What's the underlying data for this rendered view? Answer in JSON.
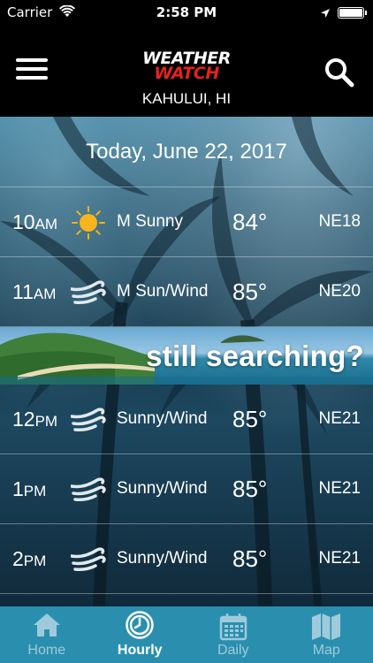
{
  "status_bar": {
    "carrier": "Carrier",
    "time": "2:58 PM"
  },
  "header": {
    "logo_line1": "WEATHER",
    "logo_line2": "WATCH",
    "location": "KAHULUI, HI"
  },
  "forecast": {
    "date": "Today, June 22, 2017",
    "hours": [
      {
        "hour": "10",
        "ampm": "AM",
        "icon": "sun-icon",
        "condition": "M Sunny",
        "temp": "84°",
        "wind": "NE18"
      },
      {
        "hour": "11",
        "ampm": "AM",
        "icon": "wind-icon",
        "condition": "M Sun/Wind",
        "temp": "85°",
        "wind": "NE20"
      },
      {
        "hour": "12",
        "ampm": "PM",
        "icon": "wind-icon",
        "condition": "Sunny/Wind",
        "temp": "85°",
        "wind": "NE21"
      },
      {
        "hour": "1",
        "ampm": "PM",
        "icon": "wind-icon",
        "condition": "Sunny/Wind",
        "temp": "85°",
        "wind": "NE21"
      },
      {
        "hour": "2",
        "ampm": "PM",
        "icon": "wind-icon",
        "condition": "Sunny/Wind",
        "temp": "85°",
        "wind": "NE21"
      }
    ]
  },
  "ad": {
    "text": "still searching?"
  },
  "tabs": [
    {
      "label": "Home",
      "icon": "home-icon",
      "active": false
    },
    {
      "label": "Hourly",
      "icon": "clock-icon",
      "active": true
    },
    {
      "label": "Daily",
      "icon": "calendar-icon",
      "active": false
    },
    {
      "label": "Map",
      "icon": "map-icon",
      "active": false
    }
  ],
  "colors": {
    "header_bg": "#000000",
    "tab_bar_bg": "#2a8fae",
    "logo_red": "#e3231e",
    "sun_yellow": "#f5b51b"
  }
}
